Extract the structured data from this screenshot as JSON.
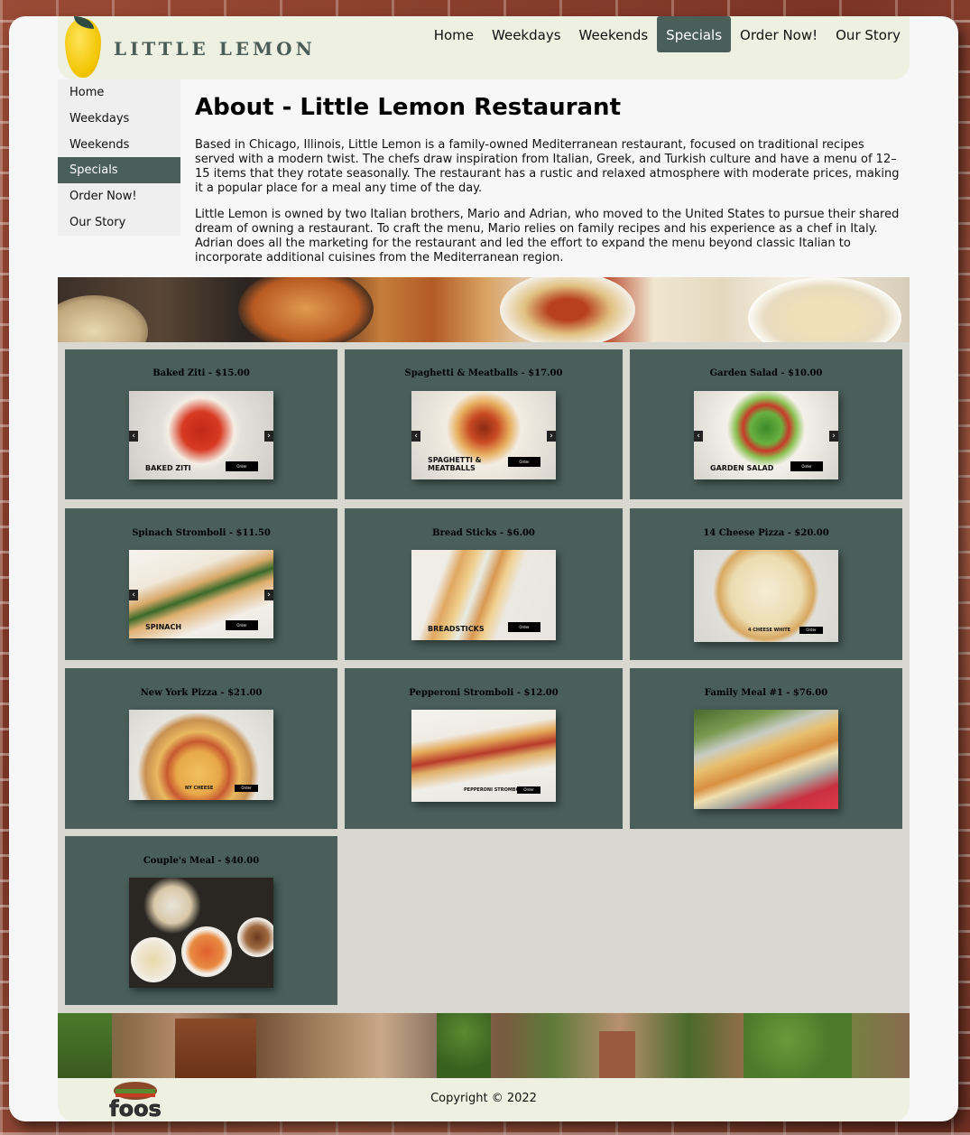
{
  "header": {
    "logo_text": "LITTLE LEMON",
    "nav": [
      "Home",
      "Weekdays",
      "Weekends",
      "Specials",
      "Order Now!",
      "Our Story"
    ],
    "active": "Specials"
  },
  "sidebar": {
    "items": [
      "Home",
      "Weekdays",
      "Weekends",
      "Specials",
      "Order Now!",
      "Our Story"
    ],
    "active": "Specials"
  },
  "about": {
    "title": "About - Little Lemon Restaurant",
    "paragraphs": [
      "Based in Chicago, Illinois, Little Lemon is a family-owned Mediterranean restaurant, focused on traditional recipes served with a modern twist. The chefs draw inspiration from Italian, Greek, and Turkish culture and have a menu of 12–15 items that they rotate seasonally. The restaurant has a rustic and relaxed atmosphere with moderate prices, making it a popular place for a meal any time of the day.",
      "Little Lemon is owned by two Italian brothers, Mario and Adrian, who moved to the United States to pursue their shared dream of owning a restaurant. To craft the menu, Mario relies on family recipes and his experience as a chef in Italy. Adrian does all the marketing for the restaurant and led the effort to expand the menu beyond classic Italian to incorporate additional cuisines from the Mediterranean region."
    ]
  },
  "menu": [
    {
      "title": "Baked Ziti - $15.00",
      "photo_label": "BAKED ZITI",
      "button": "Order",
      "arrows": true
    },
    {
      "title": "Spaghetti & Meatballs - $17.00",
      "photo_label": "SPAGHETTI & MEATBALLS",
      "button": "Order",
      "arrows": true
    },
    {
      "title": "Garden Salad - $10.00",
      "photo_label": "GARDEN SALAD",
      "button": "Order",
      "arrows": true
    },
    {
      "title": "Spinach Stromboli - $11.50",
      "photo_label": "SPINACH",
      "button": "Order",
      "arrows": true
    },
    {
      "title": "Bread Sticks - $6.00",
      "photo_label": "BREADSTICKS",
      "button": "Order",
      "arrows": false
    },
    {
      "title": "14 Cheese Pizza - $20.00",
      "photo_label": "4 CHEESE WHITE",
      "button": "Order",
      "arrows": false
    },
    {
      "title": "New York Pizza - $21.00",
      "photo_label": "NY CHEESE",
      "button": "Order",
      "arrows": false
    },
    {
      "title": "Pepperoni Stromboli - $12.00",
      "photo_label": "PEPPERONI STROMBOLI",
      "button": "Order",
      "arrows": false
    },
    {
      "title": "Family Meal #1 - $76.00",
      "photo_label": "",
      "button": "",
      "arrows": false
    },
    {
      "title": "Couple's Meal - $40.00",
      "photo_label": "",
      "button": "",
      "arrows": false
    }
  ],
  "footer": {
    "logo_text": "foos",
    "copyright": "Copyright © 2022"
  },
  "colors": {
    "accent": "#4a5f5a",
    "header_bg": "#eef0e2",
    "grid_bg": "#d8d8d0",
    "lemon": "#f2c500"
  }
}
